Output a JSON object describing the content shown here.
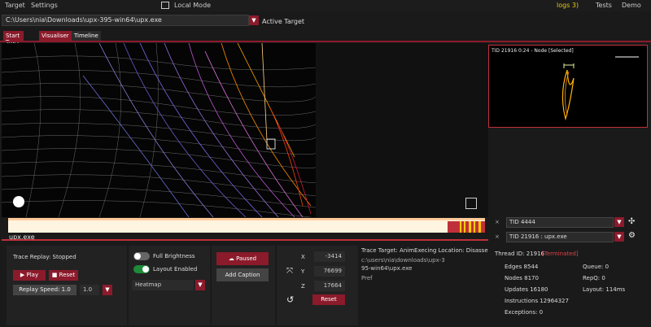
{
  "menu": {
    "target": "Target",
    "settings": "Settings",
    "local_mode": "Local Mode",
    "logs": "logs 3)",
    "tests": "Tests",
    "demo": "Demo"
  },
  "target_path": "C:\\Users\\nia\\Downloads\\upx-395-win64\\upx.exe",
  "active_target_label": "Active Target",
  "tabs": [
    "Start Trace",
    "Visualiser",
    "Timeline"
  ],
  "preview": {
    "title": "TID 21916 0:24 - Node [Selected]"
  },
  "timeline": {
    "label": "upx.exe"
  },
  "threads": {
    "top": "TID 4444",
    "bottom": "TID 21916 : upx.exe"
  },
  "replay": {
    "status": "Trace Replay: Stopped",
    "play": "Play",
    "reset": "Reset",
    "speed_label": "Replay Speed: 1.0",
    "speed_value": "1.0"
  },
  "layout": {
    "full_brightness": "Full Brightness",
    "layout_enabled": "Layout Enabled",
    "mode": "Heatmap"
  },
  "actions": {
    "paused": "Paused",
    "add_caption": "Add Caption"
  },
  "coords": {
    "x_label": "X",
    "y_label": "Y",
    "z_label": "Z",
    "x_value": "-3414",
    "y_value": "76699",
    "z_value": "17664",
    "reset": "Reset"
  },
  "trace_info": {
    "line1": "Trace Target: AnimExecing Location: Disassembly",
    "line2": "c:\\users\\nia\\downloads\\upx-3",
    "line3": "95-win64\\upx.exe",
    "line4": "Pref"
  },
  "thread_stats": {
    "title": "Thread ID: 21916",
    "state": "[Terminated]",
    "edges": "Edges 8544",
    "queue": "Queue: 0",
    "nodes": "Nodes 8170",
    "repq": "RepQ: 0",
    "updates": "Updates 16180",
    "layout": "Layout: 114ms",
    "instructions": "Instructions 12964327",
    "exceptions": "Exceptions: 0"
  },
  "colors": {
    "accent": "#8b1a2b",
    "preview_border": "#c0303a",
    "toggle_on": "#1f8a3a",
    "toggle_off": "#666666"
  }
}
